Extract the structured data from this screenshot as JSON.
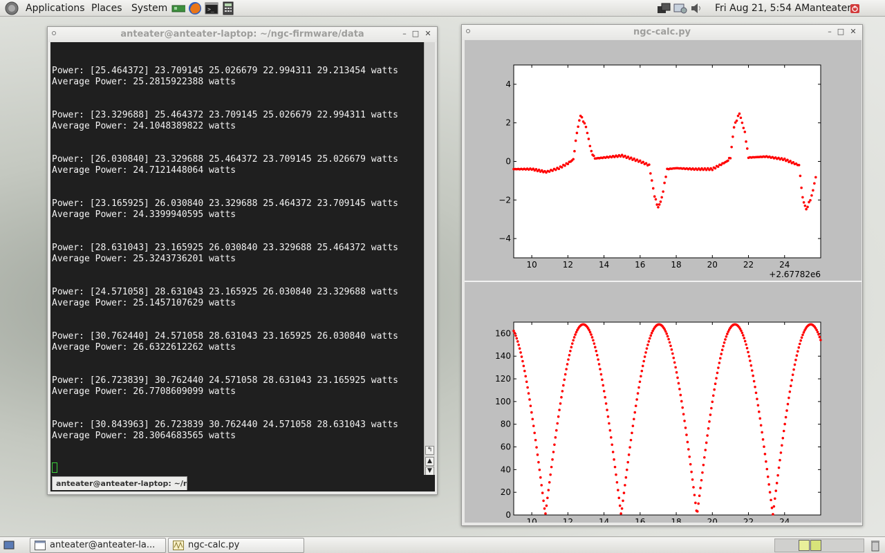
{
  "top_panel": {
    "menus": [
      "Applications",
      "Places",
      "System"
    ],
    "clock": "Fri Aug 21,  5:54 AM",
    "user": "anteater"
  },
  "terminal": {
    "title": "anteater@anteater-laptop: ~/ngc-firmware/data",
    "tab_label": "anteater@anteater-laptop: ~/ngc",
    "lines": [
      {
        "power": "Power: [25.464372] 23.709145 25.026679 22.994311 29.213454 watts",
        "avg": "Average Power: 25.2815922388 watts"
      },
      {
        "power": "Power: [23.329688] 25.464372 23.709145 25.026679 22.994311 watts",
        "avg": "Average Power: 24.1048389822 watts"
      },
      {
        "power": "Power: [26.030840] 23.329688 25.464372 23.709145 25.026679 watts",
        "avg": "Average Power: 24.7121448064 watts"
      },
      {
        "power": "Power: [23.165925] 26.030840 23.329688 25.464372 23.709145 watts",
        "avg": "Average Power: 24.3399940595 watts"
      },
      {
        "power": "Power: [28.631043] 23.165925 26.030840 23.329688 25.464372 watts",
        "avg": "Average Power: 25.3243736201 watts"
      },
      {
        "power": "Power: [24.571058] 28.631043 23.165925 26.030840 23.329688 watts",
        "avg": "Average Power: 25.1457107629 watts"
      },
      {
        "power": "Power: [30.762440] 24.571058 28.631043 23.165925 26.030840 watts",
        "avg": "Average Power: 26.6322612262 watts"
      },
      {
        "power": "Power: [26.723839] 30.762440 24.571058 28.631043 23.165925 watts",
        "avg": "Average Power: 26.7708609099 watts"
      },
      {
        "power": "Power: [30.843963] 26.723839 30.762440 24.571058 28.631043 watts",
        "avg": "Average Power: 28.3064683565 watts"
      }
    ]
  },
  "plot_window": {
    "title": "ngc-calc.py"
  },
  "taskbar": {
    "items": [
      "anteater@anteater-la...",
      "ngc-calc.py"
    ]
  },
  "chart_data": [
    {
      "type": "scatter",
      "xlim": [
        9,
        26
      ],
      "ylim": [
        -5,
        5
      ],
      "xticks": [
        "10",
        "12",
        "14",
        "16",
        "18",
        "20",
        "22",
        "24"
      ],
      "yticks": [
        "4",
        "2",
        "0",
        "−2",
        "−4"
      ],
      "x_offset_label": "+2.67782e6",
      "color": "#ff0000",
      "x": [
        9.0,
        10.0,
        10.8,
        11.5,
        12.0,
        12.3,
        12.5,
        12.7,
        13.0,
        13.3,
        13.5,
        14.0,
        15.0,
        16.0,
        16.5,
        16.8,
        17.0,
        17.2,
        17.5,
        18.0,
        19.0,
        20.0,
        20.8,
        21.0,
        21.2,
        21.5,
        21.8,
        22.0,
        23.0,
        24.0,
        24.8,
        25.0,
        25.2,
        25.5,
        25.8
      ],
      "y": [
        -0.4,
        -0.4,
        -0.55,
        -0.35,
        -0.1,
        0.1,
        1.5,
        2.4,
        1.8,
        0.5,
        0.15,
        0.2,
        0.3,
        0.0,
        -0.2,
        -1.8,
        -2.4,
        -1.9,
        -0.4,
        -0.35,
        -0.4,
        -0.4,
        0.0,
        0.2,
        1.8,
        2.5,
        1.5,
        0.2,
        0.25,
        0.1,
        -0.2,
        -1.9,
        -2.5,
        -1.8,
        -0.5
      ]
    },
    {
      "type": "scatter",
      "xlim": [
        9,
        26
      ],
      "ylim": [
        0,
        170
      ],
      "xticks": [
        "10",
        "12",
        "14",
        "16",
        "18",
        "20",
        "22",
        "24"
      ],
      "yticks": [
        "160",
        "140",
        "120",
        "100",
        "80",
        "60",
        "40",
        "20",
        "0"
      ],
      "x_offset_label": "+2.67782e6",
      "color": "#ff0000",
      "curve": {
        "peak": 168,
        "peaks_x": [
          13.05,
          17.3,
          21.5,
          25.8
        ],
        "zeros_x": [
          10.75,
          14.95,
          19.15,
          23.4
        ]
      }
    }
  ]
}
